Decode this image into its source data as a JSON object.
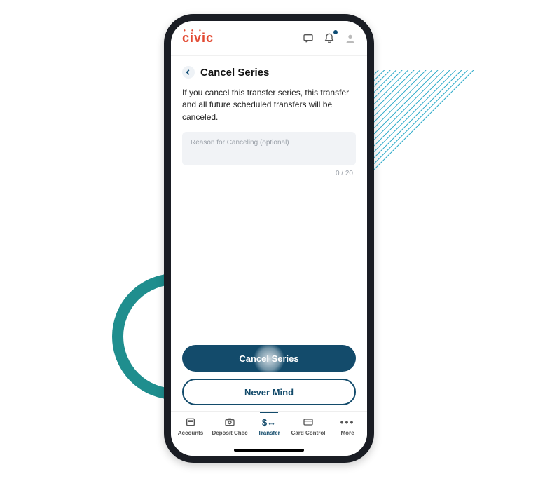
{
  "brand": {
    "name": "civic"
  },
  "header": {
    "title": "Cancel Series"
  },
  "body": {
    "description": "If you cancel this transfer series, this transfer and all future scheduled transfers will be canceled.",
    "input_placeholder": "Reason for Canceling (optional)",
    "counter": "0 / 20"
  },
  "buttons": {
    "primary": "Cancel Series",
    "secondary": "Never Mind"
  },
  "tabs": [
    {
      "label": "Accounts"
    },
    {
      "label": "Deposit Chec"
    },
    {
      "label": "Transfer"
    },
    {
      "label": "Card Control"
    },
    {
      "label": "More"
    }
  ]
}
